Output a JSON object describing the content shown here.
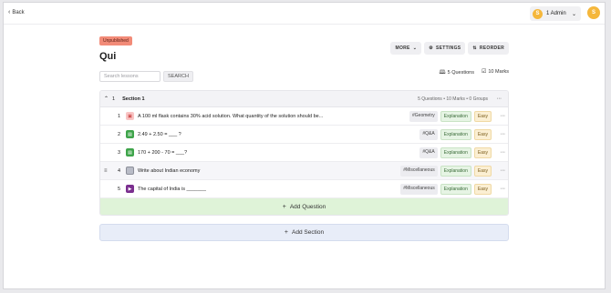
{
  "header": {
    "back_label": "Back",
    "admin_initial": "S",
    "admin_label": "1 Admin",
    "avatar_initial": "S"
  },
  "page": {
    "status_badge": "Unpublished",
    "title": "Qui",
    "actions": {
      "more": "MORE",
      "settings": "SETTINGS",
      "reorder": "REORDER"
    },
    "search": {
      "placeholder": "Search lessons",
      "button": "SEARCH"
    },
    "meta": {
      "questions": "5 Questions",
      "marks": "10 Marks"
    }
  },
  "section": {
    "number": "1",
    "name": "Section 1",
    "stats": "5 Questions • 10 Marks • 0 Groups",
    "questions": [
      {
        "num": "1",
        "icon": "image-icon",
        "text": "A 100 ml flask contains 30% acid solution. What quantity of the solution should be...",
        "category": "#Geometry",
        "explanation": "Explanation",
        "difficulty": "Easy"
      },
      {
        "num": "2",
        "icon": "fill-blank-icon",
        "text": "2.49 + 2.50 = ___ ?",
        "category": "#Q&A",
        "explanation": "Explanation",
        "difficulty": "Easy"
      },
      {
        "num": "3",
        "icon": "fill-blank-icon",
        "text": "170 + 200 - 70 = ___?",
        "category": "#Q&A",
        "explanation": "Explanation",
        "difficulty": "Easy"
      },
      {
        "num": "4",
        "icon": "essay-icon",
        "text": "Write about Indian economy",
        "category": "#Miscellaneous",
        "explanation": "Explanation",
        "difficulty": "Easy"
      },
      {
        "num": "5",
        "icon": "video-icon",
        "text": "The capital of India is _______",
        "category": "#Miscellaneous",
        "explanation": "Explanation",
        "difficulty": "Easy"
      }
    ],
    "add_question": "Add Question"
  },
  "add_section": "Add Section"
}
